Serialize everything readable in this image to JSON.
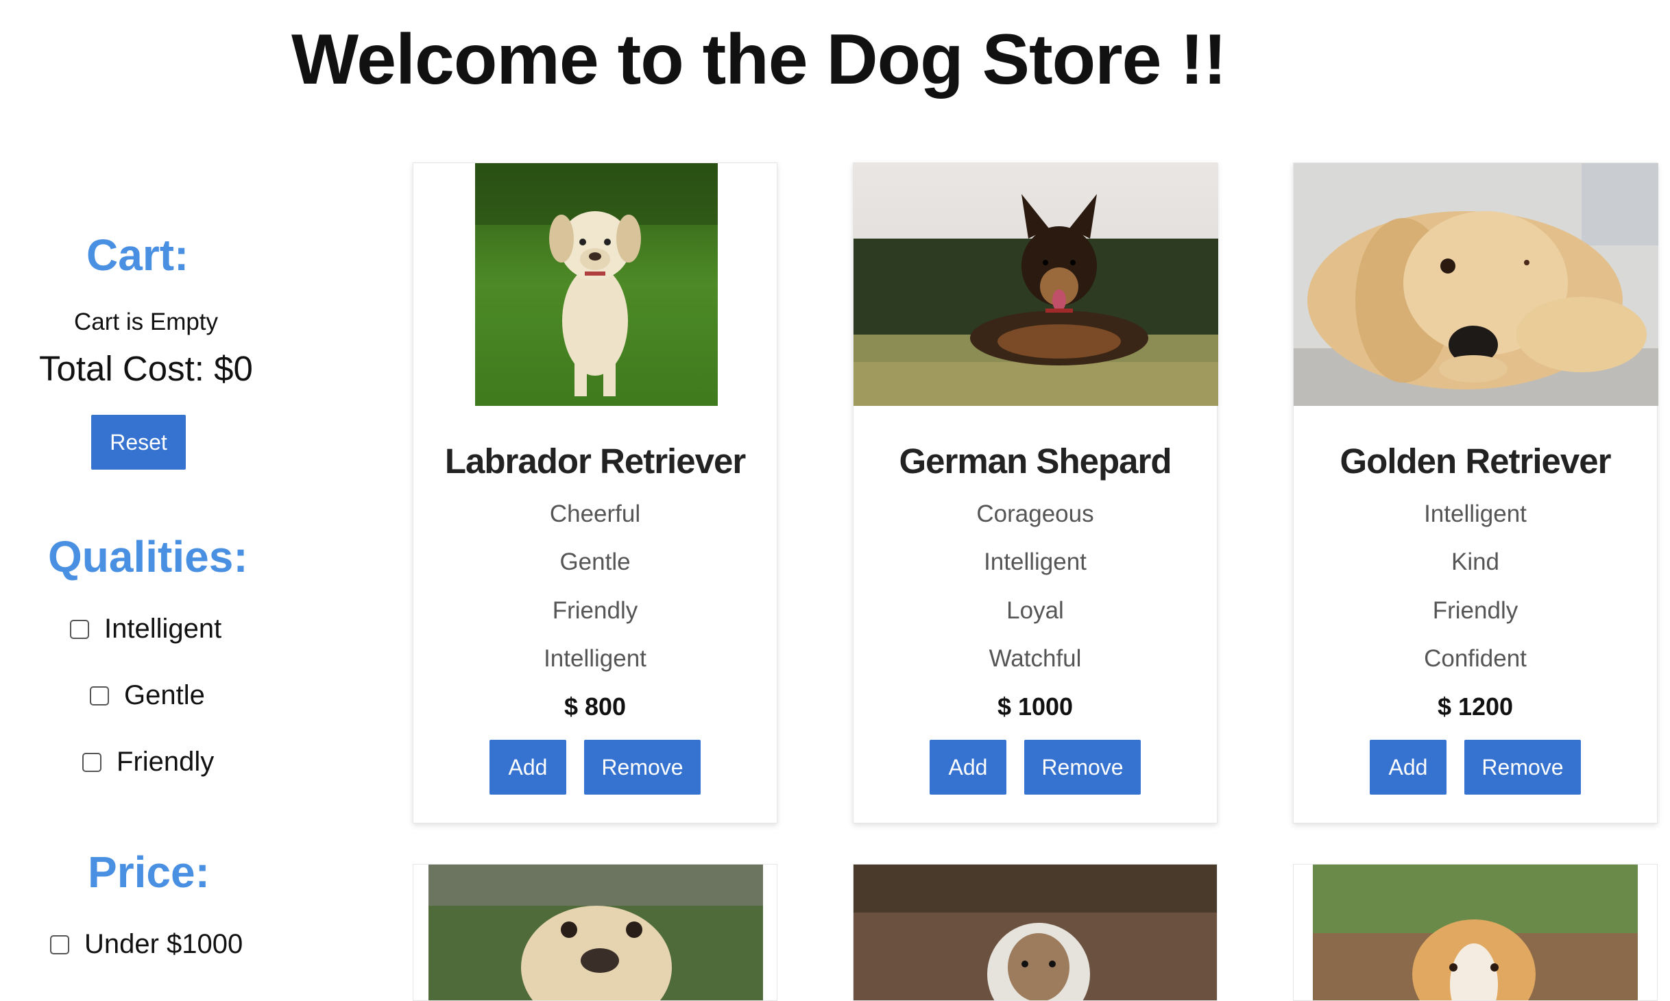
{
  "header": {
    "title": "Welcome to the Dog Store !!"
  },
  "sidebar": {
    "cart_heading": "Cart:",
    "cart_status": "Cart is Empty",
    "total_cost": "Total Cost: $0",
    "reset_label": "Reset",
    "qualities_heading": "Qualities:",
    "qualities": [
      {
        "label": "Intelligent",
        "checked": false
      },
      {
        "label": "Gentle",
        "checked": false
      },
      {
        "label": "Friendly",
        "checked": false
      }
    ],
    "price_heading": "Price:",
    "price_options": [
      {
        "label": "Under $1000",
        "checked": false
      }
    ]
  },
  "colors": {
    "accent_heading": "#4a90e2",
    "button": "#3673d1"
  },
  "dogs": [
    {
      "name": "Labrador Retriever",
      "qualities": [
        "Cheerful",
        "Gentle",
        "Friendly",
        "Intelligent"
      ],
      "price": "$ 800",
      "add_label": "Add",
      "remove_label": "Remove"
    },
    {
      "name": "German Shepard",
      "qualities": [
        "Corageous",
        "Intelligent",
        "Loyal",
        "Watchful"
      ],
      "price": "$ 1000",
      "add_label": "Add",
      "remove_label": "Remove"
    },
    {
      "name": "Golden Retriever",
      "qualities": [
        "Intelligent",
        "Kind",
        "Friendly",
        "Confident"
      ],
      "price": "$ 1200",
      "add_label": "Add",
      "remove_label": "Remove"
    }
  ]
}
